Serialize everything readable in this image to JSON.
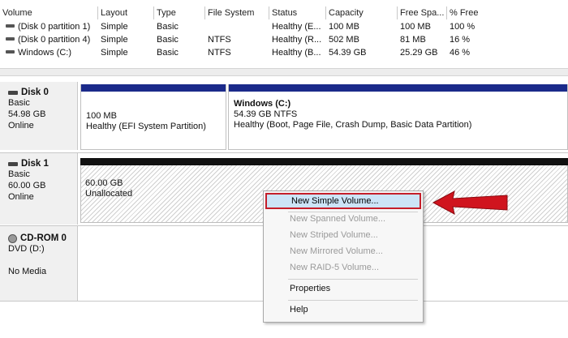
{
  "volume_list": {
    "columns": [
      "Volume",
      "Layout",
      "Type",
      "File System",
      "Status",
      "Capacity",
      "Free Spa...",
      "% Free"
    ],
    "rows": [
      {
        "volume": "(Disk 0 partition 1)",
        "layout": "Simple",
        "type": "Basic",
        "fs": "",
        "status": "Healthy (E...",
        "capacity": "100 MB",
        "free": "100 MB",
        "pct": "100 %"
      },
      {
        "volume": "(Disk 0 partition 4)",
        "layout": "Simple",
        "type": "Basic",
        "fs": "NTFS",
        "status": "Healthy (R...",
        "capacity": "502 MB",
        "free": "81 MB",
        "pct": "16 %"
      },
      {
        "volume": "Windows (C:)",
        "layout": "Simple",
        "type": "Basic",
        "fs": "NTFS",
        "status": "Healthy (B...",
        "capacity": "54.39 GB",
        "free": "25.29 GB",
        "pct": "46 %"
      }
    ]
  },
  "disks": {
    "disk0": {
      "name": "Disk 0",
      "type": "Basic",
      "size": "54.98 GB",
      "status": "Online",
      "p1": {
        "size": "100 MB",
        "status": "Healthy (EFI System Partition)"
      },
      "p2": {
        "title": "Windows  (C:)",
        "size": "54.39 GB NTFS",
        "status": "Healthy (Boot, Page File, Crash Dump, Basic Data Partition)"
      }
    },
    "disk1": {
      "name": "Disk 1",
      "type": "Basic",
      "size": "60.00 GB",
      "status": "Online",
      "unalloc": {
        "size": "60.00 GB",
        "label": "Unallocated"
      }
    },
    "cdrom": {
      "name": "CD-ROM 0",
      "drive": "DVD (D:)",
      "status": "No Media"
    }
  },
  "context_menu": {
    "items": [
      {
        "label": "New Simple Volume...",
        "state": "selected"
      },
      {
        "label": "New Spanned Volume...",
        "state": "disabled"
      },
      {
        "label": "New Striped Volume...",
        "state": "disabled"
      },
      {
        "label": "New Mirrored Volume...",
        "state": "disabled"
      },
      {
        "label": "New RAID-5 Volume...",
        "state": "disabled"
      },
      {
        "label": "Properties",
        "state": "enabled"
      },
      {
        "label": "Help",
        "state": "enabled"
      }
    ]
  },
  "colors": {
    "primary_partition_bar": "#1b2a8a",
    "unallocated_bar": "#111111",
    "highlight_border": "#c41e2a",
    "annotation_arrow": "#d0141e"
  },
  "icons": [
    "drive-icon",
    "disk-icon",
    "cd-rom-icon",
    "red-arrow-icon"
  ]
}
